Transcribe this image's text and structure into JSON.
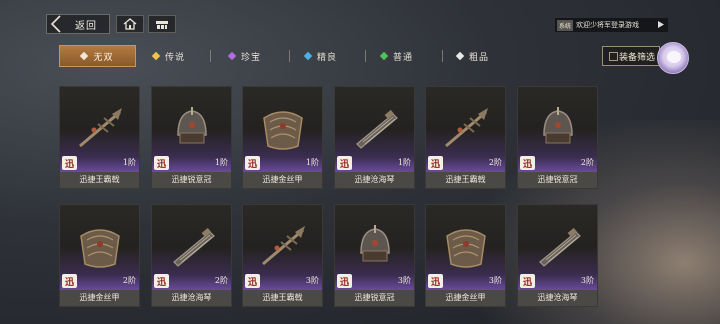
{
  "topbar": {
    "back_label": "返回",
    "ticker_badge": "系统",
    "ticker_text": "欢迎少将军登录游戏"
  },
  "tabs": [
    {
      "label": "无双",
      "color": "#f2e6d6",
      "active": true
    },
    {
      "label": "传说",
      "color": "#f0c44a",
      "active": false
    },
    {
      "label": "珍宝",
      "color": "#b46be0",
      "active": false
    },
    {
      "label": "精良",
      "color": "#4fb0e6",
      "active": false
    },
    {
      "label": "普通",
      "color": "#4fc25a",
      "active": false
    },
    {
      "label": "粗品",
      "color": "#e8e8e8",
      "active": false
    }
  ],
  "filter": {
    "label": "装备筛选"
  },
  "badge_char": "迅",
  "items": [
    {
      "name": "迅捷王霸戟",
      "tier": "1阶",
      "icon": "halberd-icon"
    },
    {
      "name": "迅捷锐意冠",
      "tier": "1阶",
      "icon": "helmet-icon"
    },
    {
      "name": "迅捷金丝甲",
      "tier": "1阶",
      "icon": "armor-icon"
    },
    {
      "name": "迅捷沧海琴",
      "tier": "1阶",
      "icon": "zither-icon"
    },
    {
      "name": "迅捷王霸戟",
      "tier": "2阶",
      "icon": "halberd-icon"
    },
    {
      "name": "迅捷锐意冠",
      "tier": "2阶",
      "icon": "helmet-icon"
    },
    {
      "name": "迅捷金丝甲",
      "tier": "2阶",
      "icon": "armor-icon"
    },
    {
      "name": "迅捷沧海琴",
      "tier": "2阶",
      "icon": "zither-icon"
    },
    {
      "name": "迅捷王霸戟",
      "tier": "3阶",
      "icon": "halberd-icon"
    },
    {
      "name": "迅捷锐意冠",
      "tier": "3阶",
      "icon": "helmet-icon"
    },
    {
      "name": "迅捷金丝甲",
      "tier": "3阶",
      "icon": "armor-icon"
    },
    {
      "name": "迅捷沧海琴",
      "tier": "3阶",
      "icon": "zither-icon"
    }
  ]
}
